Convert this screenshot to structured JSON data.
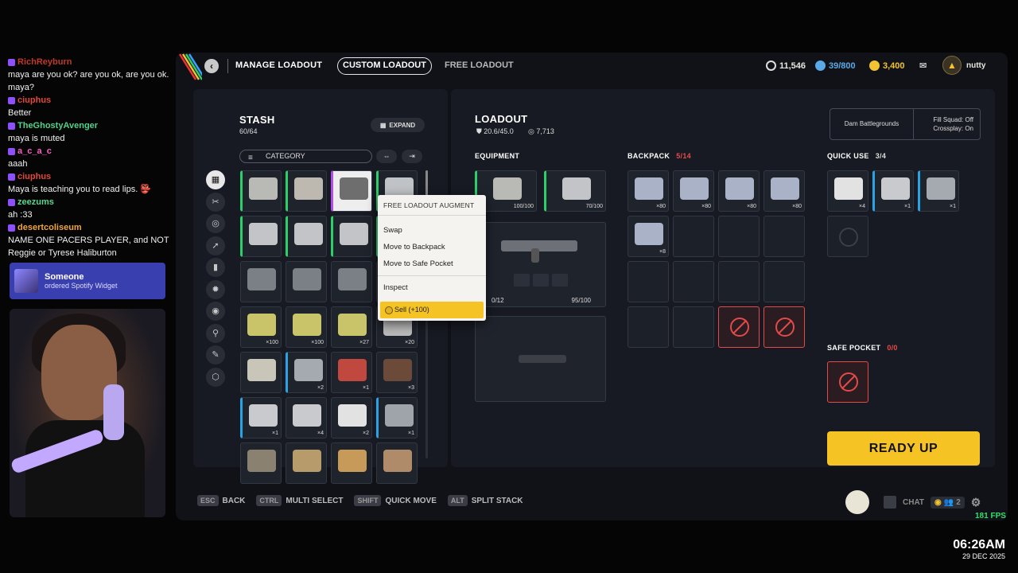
{
  "chat": [
    {
      "user": "RichReyburn",
      "color": "#c0392b",
      "text": "maya are you ok? are you ok, are you ok. maya?"
    },
    {
      "user": "ciuphus",
      "color": "#e2473b",
      "text": "Better"
    },
    {
      "user": "TheGhostyAvenger",
      "color": "#4fd38a",
      "text": "maya is muted"
    },
    {
      "user": "a_c_a_c",
      "color": "#ff5fc4",
      "text": "aaah"
    },
    {
      "user": "ciuphus",
      "color": "#e2473b",
      "text": "Maya is teaching you to read lips. 👺"
    },
    {
      "user": "zeezums",
      "color": "#59d88e",
      "text": "ah :33"
    },
    {
      "user": "desertcoliseum",
      "color": "#f2a33a",
      "text": "NAME ONE PACERS PLAYER, and NOT Reggie or Tyrese Haliburton"
    }
  ],
  "alert": {
    "name": "Someone",
    "message": "ordered Spotify Widget"
  },
  "topbar": {
    "back": "‹",
    "title": "MANAGE LOADOUT",
    "tab_custom": "CUSTOM LOADOUT",
    "tab_free": "FREE LOADOUT",
    "credits": "11,546",
    "tokens": "39/800",
    "coins": "3,400",
    "username": "nutty",
    "colors": {
      "credits": "#e8e8e8",
      "tokens": "#5aa9e6",
      "coins": "#f3c431"
    }
  },
  "stash": {
    "title": "STASH",
    "count": "60/64",
    "expand": "EXPAND",
    "category": "CATEGORY",
    "category_icons": [
      "grid-icon",
      "helmet-icon",
      "shield-icon",
      "bullet-icon",
      "ammo-icon",
      "gear-icon",
      "ring-icon",
      "tool-icon",
      "wrench-icon",
      "box-icon"
    ],
    "category_glyphs": [
      "▦",
      "✂",
      "◎",
      "➚",
      "▮",
      "✹",
      "◉",
      "⚲",
      "✎",
      "⬡"
    ],
    "slots": [
      {
        "qty": "",
        "rarity": "green",
        "color": "#b9b9b5"
      },
      {
        "qty": "",
        "rarity": "green",
        "color": "#bdb9b0"
      },
      {
        "qty": "",
        "rarity": "purple",
        "color": "#6e6e6e",
        "selected": true
      },
      {
        "qty": "",
        "rarity": "green",
        "color": "#bfc2c6"
      },
      {
        "qty": "",
        "rarity": "green",
        "color": "#c2c4c7"
      },
      {
        "qty": "",
        "rarity": "green",
        "color": "#c2c4c7"
      },
      {
        "qty": "",
        "rarity": "green",
        "color": "#c2c4c7"
      },
      {
        "qty": "",
        "rarity": "green",
        "color": "#c2c4c7"
      },
      {
        "qty": "",
        "rarity": "",
        "color": "#7b7f86"
      },
      {
        "qty": "",
        "rarity": "",
        "color": "#7b7f86"
      },
      {
        "qty": "",
        "rarity": "",
        "color": "#7b7f86"
      },
      {
        "qty": "",
        "rarity": "",
        "color": "#7b7f86"
      },
      {
        "qty": "×100",
        "rarity": "",
        "color": "#c9c36a"
      },
      {
        "qty": "×100",
        "rarity": "",
        "color": "#c9c36a"
      },
      {
        "qty": "×27",
        "rarity": "",
        "color": "#c9c36a"
      },
      {
        "qty": "×20",
        "rarity": "",
        "color": "#b9b9b9"
      },
      {
        "qty": "",
        "rarity": "",
        "color": "#c9c5b8"
      },
      {
        "qty": "×2",
        "rarity": "blue",
        "color": "#a5a9b0"
      },
      {
        "qty": "×1",
        "rarity": "",
        "color": "#c0483e"
      },
      {
        "qty": "×3",
        "rarity": "",
        "color": "#6c4a3a"
      },
      {
        "qty": "×1",
        "rarity": "blue",
        "color": "#c8cacd"
      },
      {
        "qty": "×4",
        "rarity": "",
        "color": "#c8cacd"
      },
      {
        "qty": "×2",
        "rarity": "",
        "color": "#e2e2e2"
      },
      {
        "qty": "×1",
        "rarity": "blue",
        "color": "#9fa3aa"
      },
      {
        "qty": "",
        "rarity": "",
        "color": "#8a8170"
      },
      {
        "qty": "",
        "rarity": "",
        "color": "#b79b6a"
      },
      {
        "qty": "",
        "rarity": "",
        "color": "#c79a5a"
      },
      {
        "qty": "",
        "rarity": "",
        "color": "#b08b6a"
      }
    ]
  },
  "context_menu": {
    "header": "FREE LOADOUT AUGMENT",
    "items": [
      "Swap",
      "Move to Backpack",
      "Move to Safe Pocket"
    ],
    "inspect": "Inspect",
    "sell": "Sell (+100)"
  },
  "loadout": {
    "title": "LOADOUT",
    "weight": "20.6/45.0",
    "value": "7,713",
    "equipment_label": "EQUIPMENT",
    "equip1_dur": "100/100",
    "equip2_dur": "70/100",
    "weapon_ammo": "0/12",
    "weapon_dur": "95/100",
    "backpack_label": "BACKPACK",
    "backpack_count": "5/14",
    "backpack_qty": [
      "×80",
      "×80",
      "×80",
      "×80",
      "×8"
    ],
    "quick_label": "QUICK USE",
    "quick_count": "3/4",
    "quick_qty": [
      "×4",
      "×1",
      "×1"
    ],
    "safe_label": "SAFE POCKET",
    "safe_count": "0/0",
    "map": "Dam Battlegrounds",
    "squad": "Fill Squad: Off",
    "crossplay": "Crossplay: On",
    "ready": "READY UP"
  },
  "hints": [
    {
      "key": "ESC",
      "label": "BACK"
    },
    {
      "key": "CTRL",
      "label": "MULTI SELECT"
    },
    {
      "key": "SHIFT",
      "label": "QUICK MOVE"
    },
    {
      "key": "ALT",
      "label": "SPLIT STACK"
    }
  ],
  "bottom": {
    "chat": "CHAT",
    "party": "2"
  },
  "fps": "181 FPS",
  "clock": {
    "time": "06:26AM",
    "date": "29 DEC 2025"
  }
}
